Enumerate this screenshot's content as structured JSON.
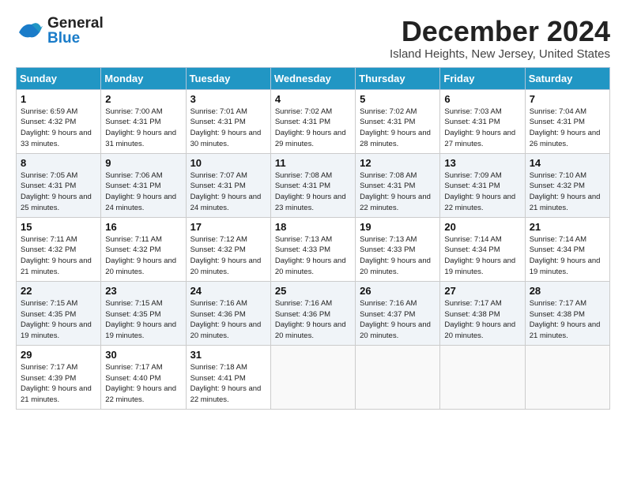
{
  "logo": {
    "general": "General",
    "blue": "Blue"
  },
  "title": "December 2024",
  "location": "Island Heights, New Jersey, United States",
  "days_of_week": [
    "Sunday",
    "Monday",
    "Tuesday",
    "Wednesday",
    "Thursday",
    "Friday",
    "Saturday"
  ],
  "weeks": [
    [
      {
        "day": "1",
        "sunrise": "Sunrise: 6:59 AM",
        "sunset": "Sunset: 4:32 PM",
        "daylight": "Daylight: 9 hours and 33 minutes."
      },
      {
        "day": "2",
        "sunrise": "Sunrise: 7:00 AM",
        "sunset": "Sunset: 4:31 PM",
        "daylight": "Daylight: 9 hours and 31 minutes."
      },
      {
        "day": "3",
        "sunrise": "Sunrise: 7:01 AM",
        "sunset": "Sunset: 4:31 PM",
        "daylight": "Daylight: 9 hours and 30 minutes."
      },
      {
        "day": "4",
        "sunrise": "Sunrise: 7:02 AM",
        "sunset": "Sunset: 4:31 PM",
        "daylight": "Daylight: 9 hours and 29 minutes."
      },
      {
        "day": "5",
        "sunrise": "Sunrise: 7:02 AM",
        "sunset": "Sunset: 4:31 PM",
        "daylight": "Daylight: 9 hours and 28 minutes."
      },
      {
        "day": "6",
        "sunrise": "Sunrise: 7:03 AM",
        "sunset": "Sunset: 4:31 PM",
        "daylight": "Daylight: 9 hours and 27 minutes."
      },
      {
        "day": "7",
        "sunrise": "Sunrise: 7:04 AM",
        "sunset": "Sunset: 4:31 PM",
        "daylight": "Daylight: 9 hours and 26 minutes."
      }
    ],
    [
      {
        "day": "8",
        "sunrise": "Sunrise: 7:05 AM",
        "sunset": "Sunset: 4:31 PM",
        "daylight": "Daylight: 9 hours and 25 minutes."
      },
      {
        "day": "9",
        "sunrise": "Sunrise: 7:06 AM",
        "sunset": "Sunset: 4:31 PM",
        "daylight": "Daylight: 9 hours and 24 minutes."
      },
      {
        "day": "10",
        "sunrise": "Sunrise: 7:07 AM",
        "sunset": "Sunset: 4:31 PM",
        "daylight": "Daylight: 9 hours and 24 minutes."
      },
      {
        "day": "11",
        "sunrise": "Sunrise: 7:08 AM",
        "sunset": "Sunset: 4:31 PM",
        "daylight": "Daylight: 9 hours and 23 minutes."
      },
      {
        "day": "12",
        "sunrise": "Sunrise: 7:08 AM",
        "sunset": "Sunset: 4:31 PM",
        "daylight": "Daylight: 9 hours and 22 minutes."
      },
      {
        "day": "13",
        "sunrise": "Sunrise: 7:09 AM",
        "sunset": "Sunset: 4:31 PM",
        "daylight": "Daylight: 9 hours and 22 minutes."
      },
      {
        "day": "14",
        "sunrise": "Sunrise: 7:10 AM",
        "sunset": "Sunset: 4:32 PM",
        "daylight": "Daylight: 9 hours and 21 minutes."
      }
    ],
    [
      {
        "day": "15",
        "sunrise": "Sunrise: 7:11 AM",
        "sunset": "Sunset: 4:32 PM",
        "daylight": "Daylight: 9 hours and 21 minutes."
      },
      {
        "day": "16",
        "sunrise": "Sunrise: 7:11 AM",
        "sunset": "Sunset: 4:32 PM",
        "daylight": "Daylight: 9 hours and 20 minutes."
      },
      {
        "day": "17",
        "sunrise": "Sunrise: 7:12 AM",
        "sunset": "Sunset: 4:32 PM",
        "daylight": "Daylight: 9 hours and 20 minutes."
      },
      {
        "day": "18",
        "sunrise": "Sunrise: 7:13 AM",
        "sunset": "Sunset: 4:33 PM",
        "daylight": "Daylight: 9 hours and 20 minutes."
      },
      {
        "day": "19",
        "sunrise": "Sunrise: 7:13 AM",
        "sunset": "Sunset: 4:33 PM",
        "daylight": "Daylight: 9 hours and 20 minutes."
      },
      {
        "day": "20",
        "sunrise": "Sunrise: 7:14 AM",
        "sunset": "Sunset: 4:34 PM",
        "daylight": "Daylight: 9 hours and 19 minutes."
      },
      {
        "day": "21",
        "sunrise": "Sunrise: 7:14 AM",
        "sunset": "Sunset: 4:34 PM",
        "daylight": "Daylight: 9 hours and 19 minutes."
      }
    ],
    [
      {
        "day": "22",
        "sunrise": "Sunrise: 7:15 AM",
        "sunset": "Sunset: 4:35 PM",
        "daylight": "Daylight: 9 hours and 19 minutes."
      },
      {
        "day": "23",
        "sunrise": "Sunrise: 7:15 AM",
        "sunset": "Sunset: 4:35 PM",
        "daylight": "Daylight: 9 hours and 19 minutes."
      },
      {
        "day": "24",
        "sunrise": "Sunrise: 7:16 AM",
        "sunset": "Sunset: 4:36 PM",
        "daylight": "Daylight: 9 hours and 20 minutes."
      },
      {
        "day": "25",
        "sunrise": "Sunrise: 7:16 AM",
        "sunset": "Sunset: 4:36 PM",
        "daylight": "Daylight: 9 hours and 20 minutes."
      },
      {
        "day": "26",
        "sunrise": "Sunrise: 7:16 AM",
        "sunset": "Sunset: 4:37 PM",
        "daylight": "Daylight: 9 hours and 20 minutes."
      },
      {
        "day": "27",
        "sunrise": "Sunrise: 7:17 AM",
        "sunset": "Sunset: 4:38 PM",
        "daylight": "Daylight: 9 hours and 20 minutes."
      },
      {
        "day": "28",
        "sunrise": "Sunrise: 7:17 AM",
        "sunset": "Sunset: 4:38 PM",
        "daylight": "Daylight: 9 hours and 21 minutes."
      }
    ],
    [
      {
        "day": "29",
        "sunrise": "Sunrise: 7:17 AM",
        "sunset": "Sunset: 4:39 PM",
        "daylight": "Daylight: 9 hours and 21 minutes."
      },
      {
        "day": "30",
        "sunrise": "Sunrise: 7:17 AM",
        "sunset": "Sunset: 4:40 PM",
        "daylight": "Daylight: 9 hours and 22 minutes."
      },
      {
        "day": "31",
        "sunrise": "Sunrise: 7:18 AM",
        "sunset": "Sunset: 4:41 PM",
        "daylight": "Daylight: 9 hours and 22 minutes."
      },
      null,
      null,
      null,
      null
    ]
  ]
}
